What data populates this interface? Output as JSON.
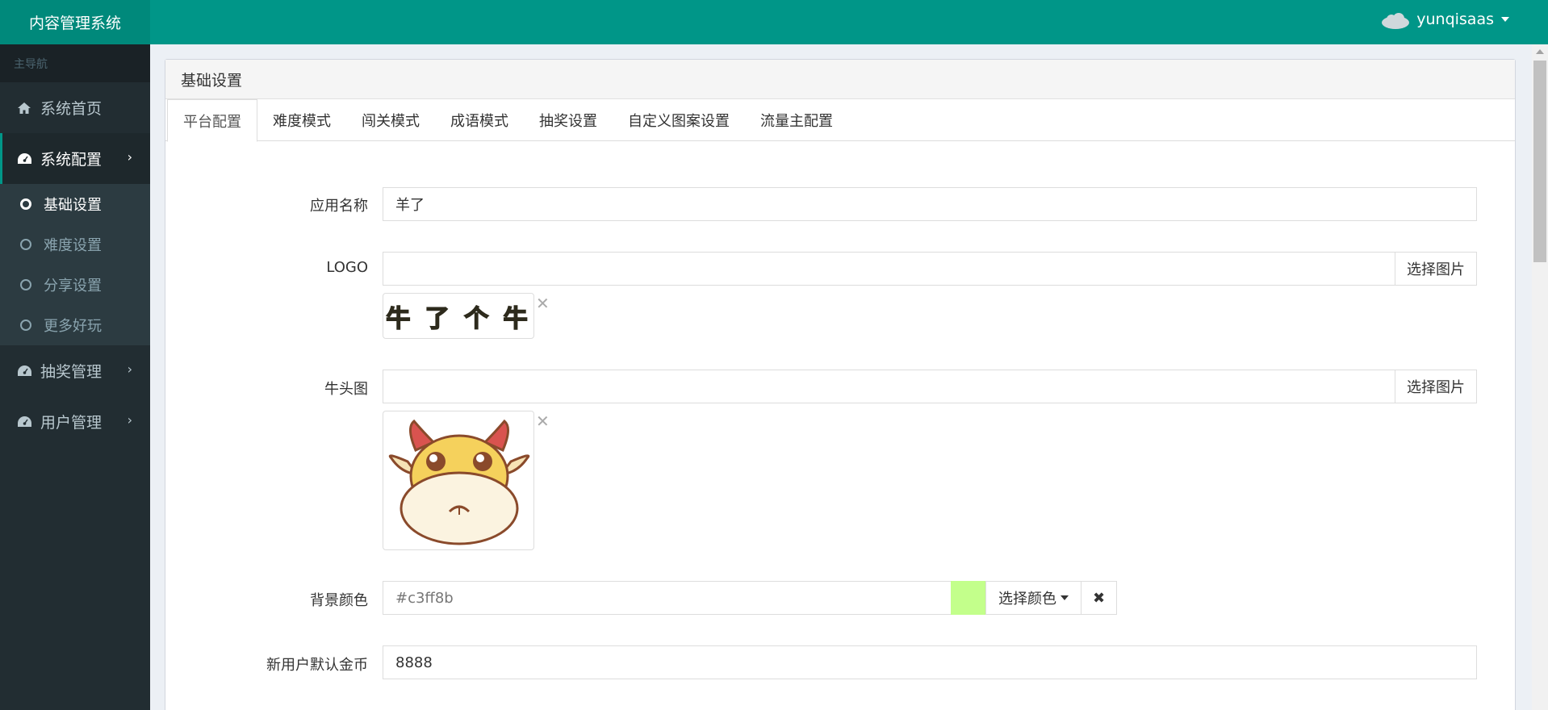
{
  "app": {
    "title": "内容管理系统"
  },
  "user": {
    "name": "yunqisaas",
    "avatar_icon": "cloud-icon"
  },
  "sidebar": {
    "header": "主导航",
    "items": [
      {
        "label": "系统首页",
        "icon": "home-icon"
      },
      {
        "label": "系统配置",
        "icon": "dashboard-icon"
      },
      {
        "label": "抽奖管理",
        "icon": "dashboard-icon"
      },
      {
        "label": "用户管理",
        "icon": "dashboard-icon"
      }
    ],
    "subitems": [
      {
        "label": "基础设置"
      },
      {
        "label": "难度设置"
      },
      {
        "label": "分享设置"
      },
      {
        "label": "更多好玩"
      }
    ]
  },
  "main": {
    "box_title": "基础设置",
    "tabs": [
      {
        "label": "平台配置"
      },
      {
        "label": "难度模式"
      },
      {
        "label": "闯关模式"
      },
      {
        "label": "成语模式"
      },
      {
        "label": "抽奖设置"
      },
      {
        "label": "自定义图案设置"
      },
      {
        "label": "流量主配置"
      }
    ],
    "form": {
      "app_name": {
        "label": "应用名称",
        "value": "羊了"
      },
      "logo": {
        "label": "LOGO",
        "value": "",
        "button": "选择图片",
        "preview_text": "牛 了 个 牛"
      },
      "cow_head": {
        "label": "牛头图",
        "value": "",
        "button": "选择图片"
      },
      "bg_color": {
        "label": "背景颜色",
        "placeholder": "#c3ff8b",
        "swatch": "#c3ff8b",
        "button": "选择颜色",
        "clear": "✖"
      },
      "coins": {
        "label": "新用户默认金币",
        "value": "8888"
      }
    }
  },
  "colors": {
    "topbar": "#009688",
    "sidebar": "#222d32"
  }
}
